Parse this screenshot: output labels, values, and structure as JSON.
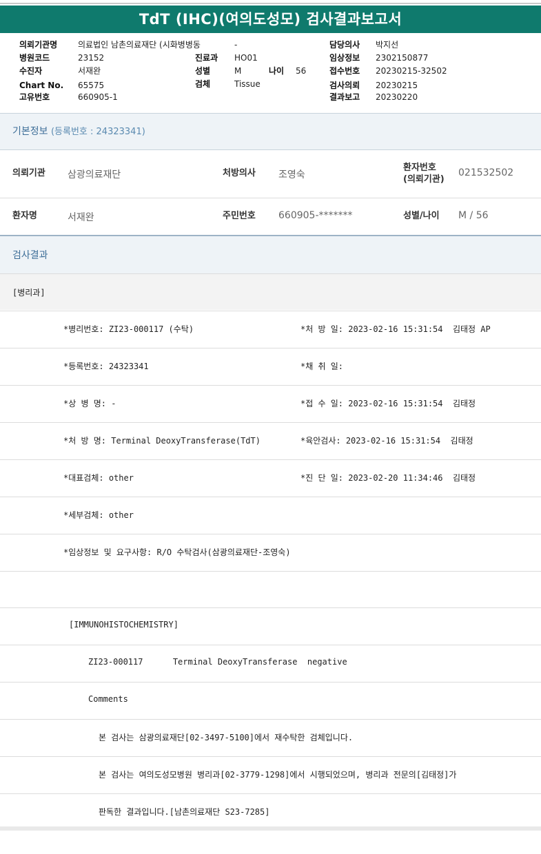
{
  "title": "TdT (IHC)(여의도성모) 검사결과보고서",
  "header": {
    "labels": {
      "institution": "의뢰기관명",
      "hospital_code": "병원코드",
      "patient": "수진자",
      "chart_no": "Chart No.",
      "unique_no": "고유번호",
      "dept": "진료과",
      "sex": "성별",
      "age": "나이",
      "specimen": "검체",
      "doctor": "담당의사",
      "clinical_info": "임상정보",
      "receipt_no": "접수번호",
      "request_date": "검사의뢰",
      "report_date": "결과보고"
    },
    "values": {
      "institution": "의료법인 남촌의료재단 (시화병병동",
      "ward": "-",
      "hospital_code": "23152",
      "patient": "서재완",
      "chart_no": "65575",
      "unique_no": "660905-1",
      "dept": "HO01",
      "sex": "M",
      "age": "56",
      "specimen": "Tissue",
      "doctor": "박지선",
      "clinical_info": "2302150877",
      "receipt_no": "20230215-32502",
      "request_date": "20230215",
      "report_date": "20230220"
    }
  },
  "basic_info": {
    "title": "기본정보",
    "reg_no": "(등록번호 : 24323341)",
    "labels": {
      "institution": "의뢰기관",
      "prescriber": "처방의사",
      "patient_no_line1": "환자번호",
      "patient_no_line2": "(의뢰기관)",
      "patient_name": "환자명",
      "resident_no": "주민번호",
      "sex_age": "성별/나이"
    },
    "values": {
      "institution": "삼광의료재단",
      "prescriber": "조영숙",
      "patient_no": "021532502",
      "patient_name": "서재완",
      "resident_no": "660905-*******",
      "sex_age": "M / 56"
    }
  },
  "results": {
    "title": "검사결과",
    "dept": "[병리과]",
    "rows": [
      {
        "left": "*병리번호: ZI23-000117 (수탁)",
        "right": "*처 방 일: 2023-02-16 15:31:54  김태정 AP"
      },
      {
        "left": "*등록번호: 24323341",
        "right": "*채 취 일:"
      },
      {
        "left": "*상 병 명: -",
        "right": "*접 수 일: 2023-02-16 15:31:54  김태정"
      },
      {
        "left": "*처 방 명: Terminal DeoxyTransferase(TdT)",
        "right": "*육안검사: 2023-02-16 15:31:54  김태정"
      },
      {
        "left": "*대표검체: other",
        "right": "*진 단 일: 2023-02-20 11:34:46  김태정"
      },
      {
        "left": "*세부검체: other",
        "right": ""
      },
      {
        "left": "*임상정보 및 요구사항: R/O 수탁검사(삼광의료재단-조영숙)",
        "right": ""
      }
    ],
    "ihc_heading": "[IMMUNOHISTOCHEMISTRY]",
    "ihc_line": "ZI23-000117      Terminal DeoxyTransferase  negative",
    "comments_label": "Comments",
    "comment_lines": [
      "본 검사는 삼광의료재단[02-3497-5100]에서 재수탁한 검체입니다.",
      "본 검사는 여의도성모병원 병리과[02-3779-1298]에서 시행되었으며, 병리과 전문의[김태정]가",
      "판독한 결과입니다.[남촌의료재단 S23-7285]"
    ]
  }
}
